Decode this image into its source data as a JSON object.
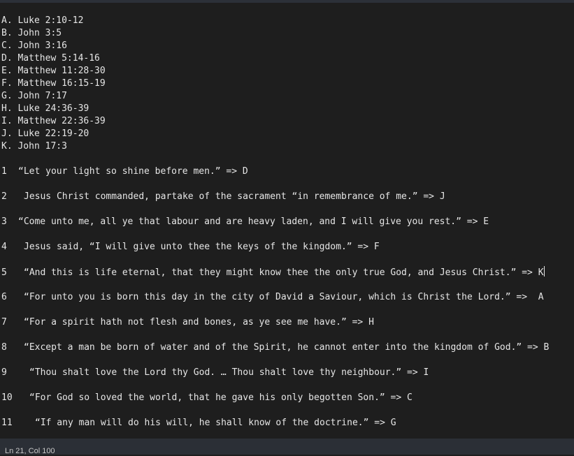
{
  "options": [
    "A. Luke 2:10-12",
    "B. John 3:5",
    "C. John 3:16",
    "D. Matthew 5:14-16",
    "E. Matthew 11:28-30",
    "F. Matthew 16:15-19",
    "G. John 7:17",
    "H. Luke 24:36-39",
    "I. Matthew 22:36-39",
    "J. Luke 22:19-20",
    "K. John 17:3"
  ],
  "questions": [
    {
      "num": "1",
      "text": "“Let your light so shine before men.” => D"
    },
    {
      "num": "2",
      "text": "Jesus Christ commanded, partake of the sacrament “in remembrance of me.” => J"
    },
    {
      "num": "3",
      "text": "“Come unto me, all ye that labour and are heavy laden, and I will give you rest.” => E"
    },
    {
      "num": "4",
      "text": "Jesus said, “I will give unto thee the keys of the kingdom.” => F"
    },
    {
      "num": "5",
      "text": "“And this is life eternal, that they might know thee the only true God, and Jesus Christ.” => K"
    },
    {
      "num": "6",
      "text": "“For unto you is born this day in the city of David a Saviour, which is Christ the Lord.” =>  A"
    },
    {
      "num": "7",
      "text": "“For a spirit hath not flesh and bones, as ye see me have.” => H"
    },
    {
      "num": "8",
      "text": "“Except a man be born of water and of the Spirit, he cannot enter into the kingdom of God.” => B"
    },
    {
      "num": "9",
      "text": "“Thou shalt love the Lord thy God. … Thou shalt love thy neighbour.” => I"
    },
    {
      "num": "10",
      "text": "“For God so loved the world, that he gave his only begotten Son.” => C"
    },
    {
      "num": "11",
      "text": "“If any man will do his will, he shall know of the doctrine.” => G"
    }
  ],
  "status": {
    "position": "Ln 21, Col 100"
  }
}
